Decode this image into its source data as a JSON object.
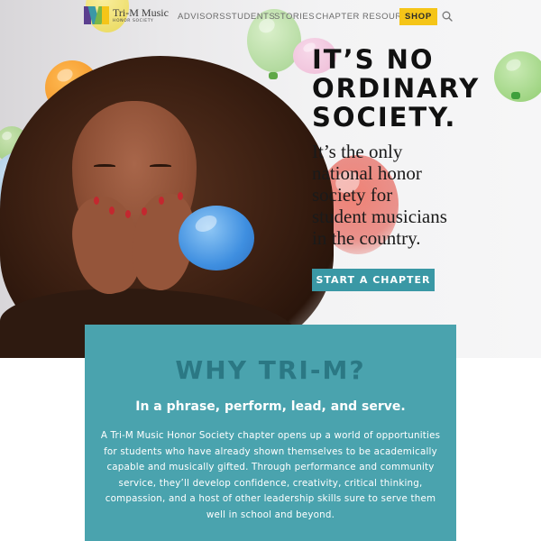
{
  "brand": {
    "name": "Tri-M Music",
    "subtitle": "HONOR SOCIETY",
    "colors": {
      "purple": "#5b3f8f",
      "teal": "#3a98a5",
      "yellow": "#f5c518",
      "green": "#7ab648"
    }
  },
  "nav": {
    "items": [
      {
        "label": "ADVISORS"
      },
      {
        "label": "STUDENTS"
      },
      {
        "label": "STORIES"
      },
      {
        "label": "CHAPTER RESOURCES"
      }
    ],
    "shop_label": "SHOP",
    "search_icon": "search-icon"
  },
  "hero": {
    "headline_lines": [
      "IT’S NO",
      "ORDINARY",
      "SOCIETY."
    ],
    "tagline_lines": [
      "It’s the only",
      "national honor",
      "society for",
      "student musicians",
      "in the country."
    ],
    "cta_label": "START A CHAPTER",
    "accent": "#3a98a5"
  },
  "why": {
    "title": "WHY TRI-M?",
    "subtitle": "In a phrase, perform, lead, and serve.",
    "body_lines": [
      "A Tri-M Music Honor Society chapter opens up a world of opportunities",
      "for students who have already shown themselves to be academically",
      "capable and musically gifted. Through performance and community",
      "service, they’ll develop confidence, creativity, critical thinking,",
      "compassion, and a host of other leadership skills sure to serve them",
      "well in school and beyond."
    ],
    "background": "#4aa3ae"
  }
}
